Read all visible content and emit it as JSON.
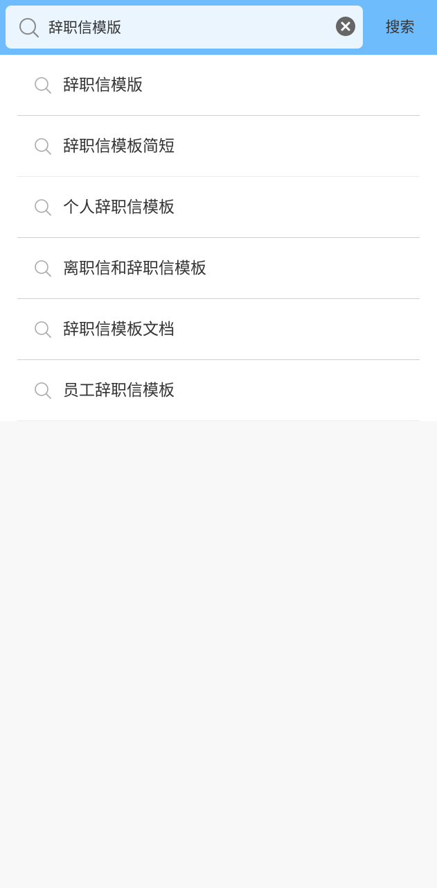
{
  "search": {
    "value": "辞职信模版",
    "button_label": "搜索"
  },
  "colors": {
    "header_bg": "#6fbcfd",
    "search_box_bg": "#eaf5fe",
    "text": "#333333",
    "clear_icon": "#666666"
  },
  "icons": {
    "search": "search-icon",
    "clear": "clear-icon",
    "suggestion": "search-icon"
  },
  "suggestions": [
    {
      "label": "辞职信模版"
    },
    {
      "label": "辞职信模板简短"
    },
    {
      "label": "个人辞职信模板"
    },
    {
      "label": "离职信和辞职信模板"
    },
    {
      "label": "辞职信模板文档"
    },
    {
      "label": "员工辞职信模板"
    }
  ]
}
